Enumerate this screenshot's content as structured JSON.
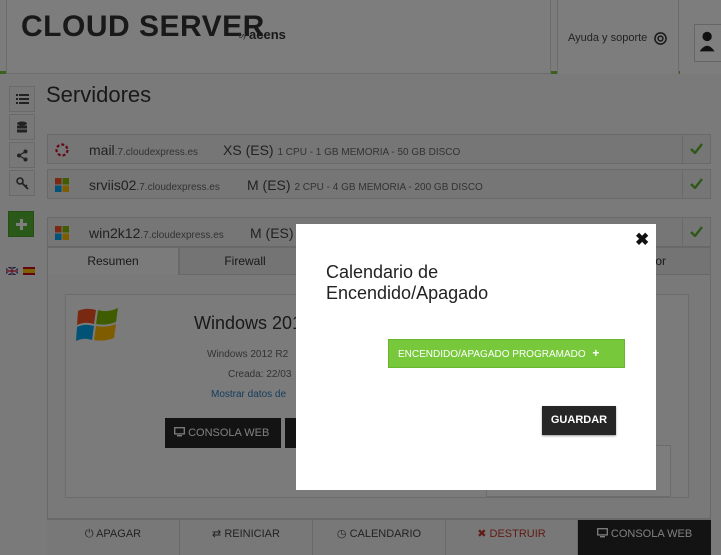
{
  "header": {
    "brand": "CLOUD SERVER",
    "brand_by": "by",
    "brand_company": "acens",
    "help_label": "Ayuda y soporte"
  },
  "page_title": "Servidores",
  "servers": [
    {
      "name": "mail",
      "domain": ".7.cloudexpress.es",
      "size": "XS (ES)",
      "specs": "1 CPU - 1 GB MEMORIA - 50 GB DISCO"
    },
    {
      "name": "srviis02",
      "domain": ".7.cloudexpress.es",
      "size": "M (ES)",
      "specs": "2 CPU - 4 GB MEMORIA - 200 GB DISCO"
    },
    {
      "name": "win2k12",
      "domain": ".7.cloudexpress.es",
      "size": "M (ES)",
      "specs": ""
    }
  ],
  "tabs": [
    "Resumen",
    "Firewall",
    "or"
  ],
  "detail": {
    "os_title": "Windows 201",
    "os_line": "Windows 2012 R2",
    "created": "Creada: 22/03",
    "show_data": "Mostrar datos de",
    "console_btn": "CONSOLA WEB"
  },
  "actions": {
    "shutdown": "APAGAR",
    "restart": "REINICIAR",
    "calendar": "CALENDARIO",
    "destroy": "DESTRUIR",
    "console": "CONSOLA WEB"
  },
  "modal": {
    "close": "✖",
    "title": "Calendario de Encendido/Apagado",
    "schedule_btn": "ENCENDIDO/APAGADO PROGRAMADO",
    "save_btn": "GUARDAR"
  },
  "colors": {
    "accent": "#78c13c",
    "danger": "#c0392b",
    "dark": "#262626"
  }
}
